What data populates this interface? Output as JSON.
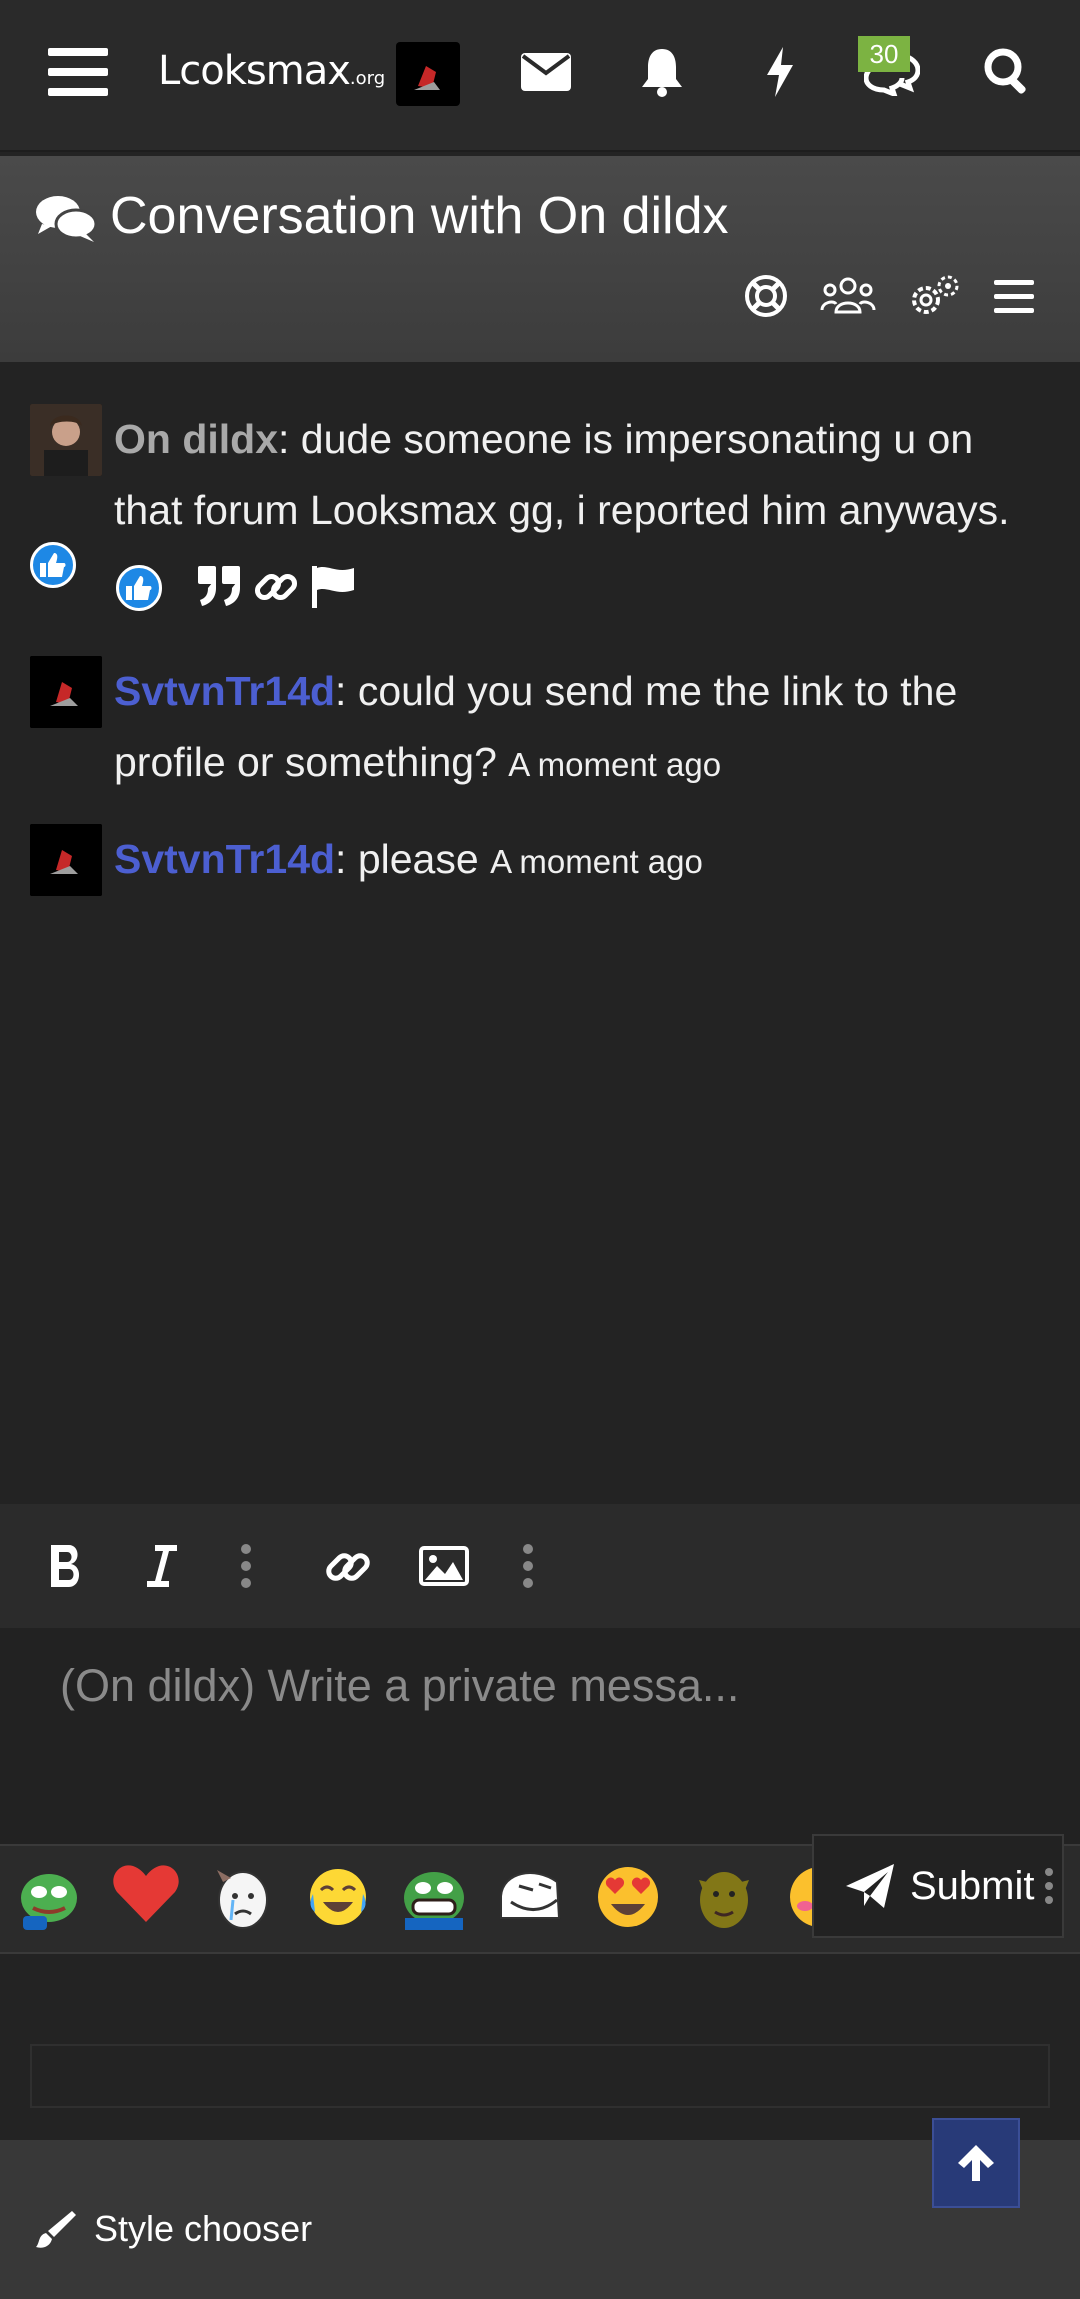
{
  "nav": {
    "logo_main": "Lcoksmax",
    "logo_suffix": ".org",
    "chat_badge": "30"
  },
  "conversation": {
    "title": "Conversation with On dildx"
  },
  "messages": [
    {
      "author": "On dildx",
      "text": ": dude someone is impersonating u on that forum Looksmax gg, i reported him anyways.",
      "time": ""
    },
    {
      "author": "SvtvnTr14d",
      "text": ": could you send me the link to the profile or something?",
      "time": "A moment ago"
    },
    {
      "author": "SvtvnTr14d",
      "text": ": please",
      "time": "A moment ago"
    }
  ],
  "editor": {
    "placeholder": "(On dildx) Write a private messa..."
  },
  "submit": {
    "label": "Submit"
  },
  "footer": {
    "style_chooser": "Style chooser"
  },
  "colors": {
    "badge": "#7cb342",
    "username_self": "#4c5fd1",
    "username_other": "#a9a9a9",
    "scroll_top": "#283a78"
  }
}
